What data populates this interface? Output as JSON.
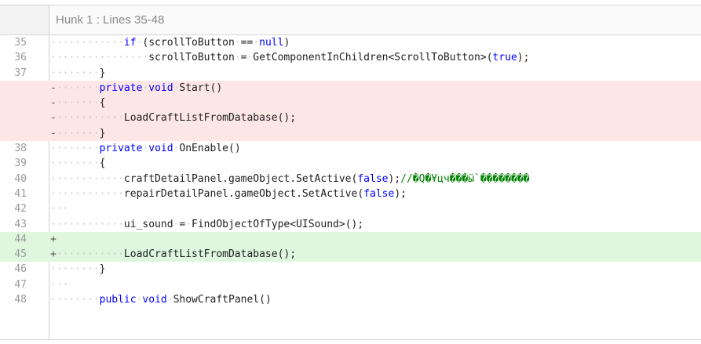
{
  "hunk": {
    "title": "Hunk 1 : Lines 35-48"
  },
  "lines": [
    {
      "num": "35",
      "type": "ctx",
      "marker": "",
      "indent": 12,
      "segments": [
        {
          "t": "kw",
          "v": "if"
        },
        {
          "t": "sp",
          "v": " "
        },
        {
          "t": "tx",
          "v": "(scrollToButton"
        },
        {
          "t": "sp",
          "v": " "
        },
        {
          "t": "tx",
          "v": "=="
        },
        {
          "t": "sp",
          "v": " "
        },
        {
          "t": "kw",
          "v": "null"
        },
        {
          "t": "tx",
          "v": ")"
        }
      ]
    },
    {
      "num": "36",
      "type": "ctx",
      "marker": "",
      "indent": 16,
      "segments": [
        {
          "t": "tx",
          "v": "scrollToButton"
        },
        {
          "t": "sp",
          "v": " "
        },
        {
          "t": "tx",
          "v": "="
        },
        {
          "t": "sp",
          "v": " "
        },
        {
          "t": "tx",
          "v": "GetComponentInChildren<ScrollToButton>("
        },
        {
          "t": "kw",
          "v": "true"
        },
        {
          "t": "tx",
          "v": ");"
        }
      ]
    },
    {
      "num": "37",
      "type": "ctx",
      "marker": "",
      "indent": 8,
      "segments": [
        {
          "t": "tx",
          "v": "}"
        }
      ]
    },
    {
      "num": "",
      "type": "del",
      "marker": "-",
      "indent": 8,
      "segments": [
        {
          "t": "kw",
          "v": "private"
        },
        {
          "t": "sp",
          "v": " "
        },
        {
          "t": "kw",
          "v": "void"
        },
        {
          "t": "sp",
          "v": " "
        },
        {
          "t": "tx",
          "v": "Start()"
        }
      ]
    },
    {
      "num": "",
      "type": "del",
      "marker": "-",
      "indent": 8,
      "segments": [
        {
          "t": "tx",
          "v": "{"
        }
      ]
    },
    {
      "num": "",
      "type": "del",
      "marker": "-",
      "indent": 12,
      "segments": [
        {
          "t": "tx",
          "v": "LoadCraftListFromDatabase();"
        }
      ]
    },
    {
      "num": "",
      "type": "del",
      "marker": "-",
      "indent": 8,
      "segments": [
        {
          "t": "tx",
          "v": "}"
        }
      ]
    },
    {
      "num": "38",
      "type": "ctx",
      "marker": "",
      "indent": 8,
      "segments": [
        {
          "t": "kw",
          "v": "private"
        },
        {
          "t": "sp",
          "v": " "
        },
        {
          "t": "kw",
          "v": "void"
        },
        {
          "t": "sp",
          "v": " "
        },
        {
          "t": "tx",
          "v": "OnEnable()"
        }
      ]
    },
    {
      "num": "39",
      "type": "ctx",
      "marker": "",
      "indent": 8,
      "segments": [
        {
          "t": "tx",
          "v": "{"
        }
      ]
    },
    {
      "num": "40",
      "type": "ctx",
      "marker": "",
      "indent": 12,
      "segments": [
        {
          "t": "tx",
          "v": "craftDetailPanel.gameObject.SetActive("
        },
        {
          "t": "kw",
          "v": "false"
        },
        {
          "t": "tx",
          "v": ");"
        },
        {
          "t": "cm",
          "v": "//�Q�¥цч���ӹ`��������"
        }
      ]
    },
    {
      "num": "41",
      "type": "ctx",
      "marker": "",
      "indent": 12,
      "segments": [
        {
          "t": "tx",
          "v": "repairDetailPanel.gameObject.SetActive("
        },
        {
          "t": "kw",
          "v": "false"
        },
        {
          "t": "tx",
          "v": ");"
        }
      ]
    },
    {
      "num": "42",
      "type": "ctx",
      "marker": "",
      "indent": 3,
      "segments": []
    },
    {
      "num": "43",
      "type": "ctx",
      "marker": "",
      "indent": 12,
      "segments": [
        {
          "t": "tx",
          "v": "ui_sound"
        },
        {
          "t": "sp",
          "v": " "
        },
        {
          "t": "tx",
          "v": "="
        },
        {
          "t": "sp",
          "v": " "
        },
        {
          "t": "tx",
          "v": "FindObjectOfType<UISound>();"
        }
      ]
    },
    {
      "num": "44",
      "type": "add",
      "marker": "+",
      "indent": 0,
      "segments": []
    },
    {
      "num": "45",
      "type": "add",
      "marker": "+",
      "indent": 12,
      "segments": [
        {
          "t": "tx",
          "v": "LoadCraftListFromDatabase();"
        }
      ]
    },
    {
      "num": "46",
      "type": "ctx",
      "marker": "",
      "indent": 8,
      "segments": [
        {
          "t": "tx",
          "v": "}"
        }
      ]
    },
    {
      "num": "47",
      "type": "ctx",
      "marker": "",
      "indent": 3,
      "segments": []
    },
    {
      "num": "48",
      "type": "ctx",
      "marker": "",
      "indent": 8,
      "segments": [
        {
          "t": "kw",
          "v": "public"
        },
        {
          "t": "sp",
          "v": " "
        },
        {
          "t": "kw",
          "v": "void"
        },
        {
          "t": "sp",
          "v": " "
        },
        {
          "t": "tx",
          "v": "ShowCraftPanel()"
        }
      ]
    }
  ]
}
